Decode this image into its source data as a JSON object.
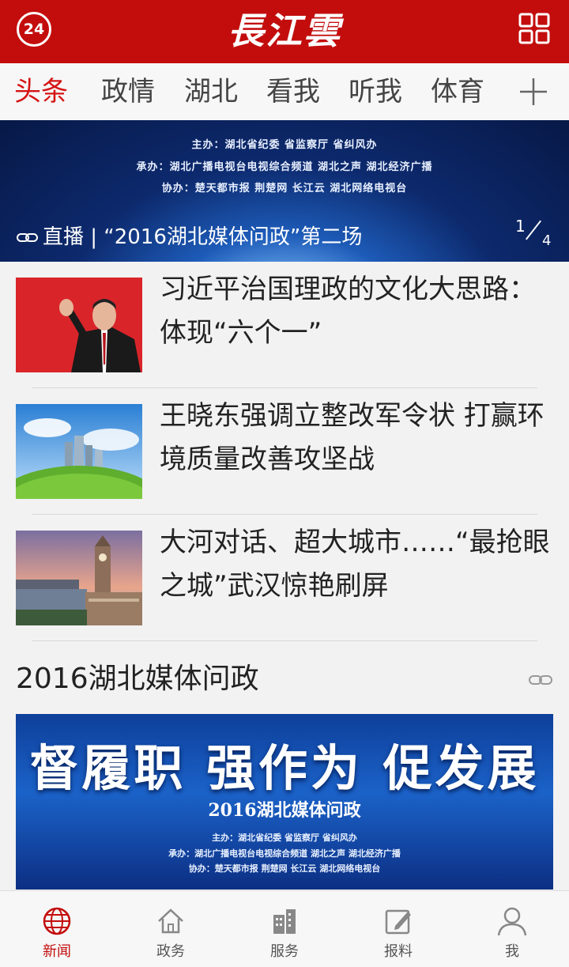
{
  "header": {
    "badge": "24",
    "logo": "長江雲",
    "menu_icon": "grid-icon"
  },
  "tabs": [
    "头条",
    "政情",
    "湖北",
    "看我",
    "听我",
    "体育"
  ],
  "tabs_more_icon": "plus-icon",
  "hero": {
    "lines": [
      "主办：湖北省纪委  省监察厅  省纠风办",
      "承办：湖北广播电视台电视综合频道  湖北之声  湖北经济广播",
      "协办：楚天都市报  荆楚网  长江云  湖北网络电视台"
    ],
    "caption": "直播 | “2016湖北媒体问政”第二场",
    "page_current": "1",
    "page_total": "4"
  },
  "news": [
    {
      "title": "习近平治国理政的文化大思路：体现“六个一”"
    },
    {
      "title": "王晓东强调立整改军令状 打赢环境质量改善攻坚战"
    },
    {
      "title": "大河对话、超大城市……“最抢眼之城”武汉惊艳刷屏"
    }
  ],
  "section": {
    "title": "2016湖北媒体问政",
    "banner": {
      "headline": "督履职 强作为 促发展",
      "sub": "2016湖北媒体问政",
      "lines": [
        "主办：湖北省纪委  省监察厅  省纠风办",
        "承办：湖北广播电视台电视综合频道  湖北之声  湖北经济广播",
        "协办：楚天都市报  荆楚网  长江云  湖北网络电视台"
      ]
    }
  },
  "bottom_nav": [
    {
      "label": "新闻",
      "icon": "globe-icon"
    },
    {
      "label": "政务",
      "icon": "home-icon"
    },
    {
      "label": "服务",
      "icon": "building-icon"
    },
    {
      "label": "报料",
      "icon": "edit-icon"
    },
    {
      "label": "我",
      "icon": "user-icon"
    }
  ],
  "colors": {
    "brand_red": "#c30d0d",
    "active_tab": "#d51414"
  }
}
